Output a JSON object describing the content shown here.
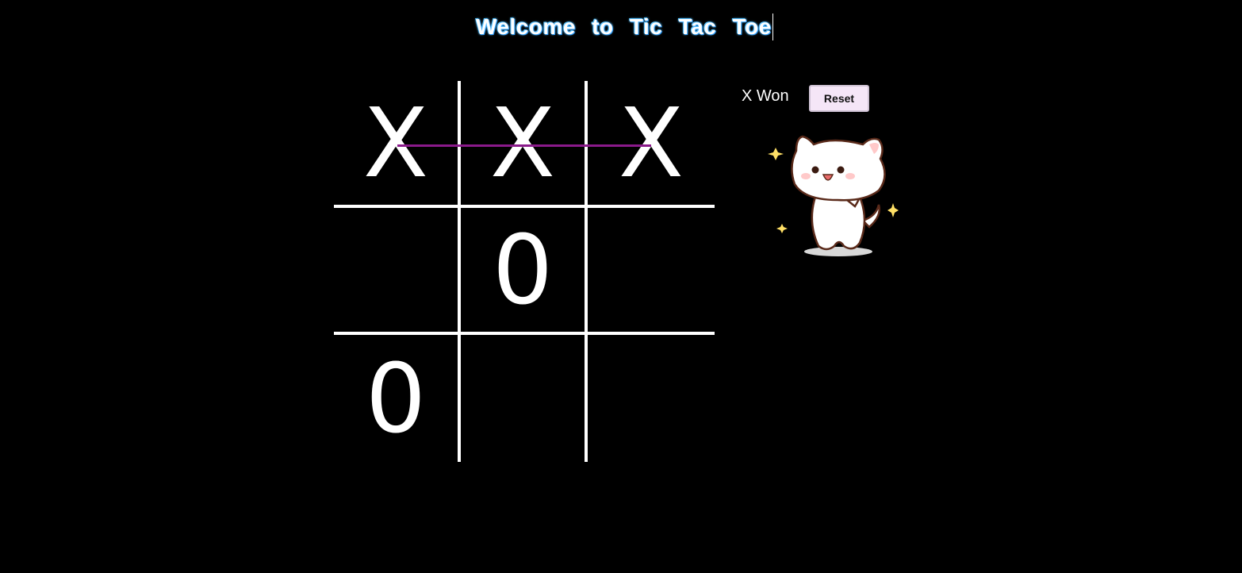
{
  "header": {
    "title": "Welcome to Tic Tac Toe"
  },
  "board": {
    "cells": [
      [
        "X",
        "X",
        "X"
      ],
      [
        "",
        "0",
        ""
      ],
      [
        "0",
        "",
        ""
      ]
    ],
    "winning_line": "row-1",
    "winning_line_color": "#8b1a8b",
    "line_color": "#ffffff"
  },
  "status": {
    "text": "X Won"
  },
  "controls": {
    "reset_label": "Reset"
  },
  "celebration": {
    "icon": "happy-cat-icon",
    "sparkle_color": "#ffe066"
  },
  "colors": {
    "background": "#000000",
    "title_glow": "#4db8ff",
    "reset_bg": "#f5e6f7"
  }
}
